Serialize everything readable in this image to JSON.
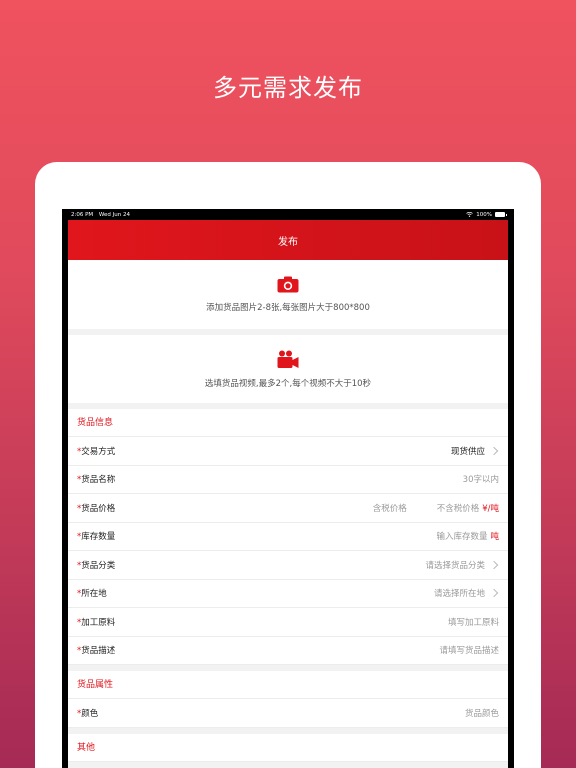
{
  "headline": "多元需求发布",
  "status_bar": {
    "time": "2:06 PM",
    "date": "Wed Jun 24",
    "battery": "100%"
  },
  "nav": {
    "title": "发布"
  },
  "photo_upload": {
    "icon": "camera-icon",
    "hint": "添加货品图片2-8张,每张图片大于800*800"
  },
  "video_upload": {
    "icon": "video-camera-icon",
    "hint": "选填货品视频,最多2个,每个视频不大于10秒"
  },
  "sections": {
    "goods_info": "货品信息",
    "goods_attrs": "货品属性",
    "other": "其他"
  },
  "form": {
    "required_mark": "*",
    "trade_mode": {
      "label": "交易方式",
      "value": "现货供应"
    },
    "goods_name": {
      "label": "货品名称",
      "placeholder": "30字以内"
    },
    "price": {
      "label": "货品价格",
      "incl_tax": "含税价格",
      "excl_tax": "不含税价格",
      "unit": "¥/吨"
    },
    "stock": {
      "label": "库存数量",
      "placeholder": "输入库存数量",
      "unit": "吨"
    },
    "category": {
      "label": "货品分类",
      "placeholder": "请选择货品分类"
    },
    "location": {
      "label": "所在地",
      "placeholder": "请选择所在地"
    },
    "raw_material": {
      "label": "加工原料",
      "placeholder": "填写加工原料"
    },
    "description": {
      "label": "货品描述",
      "placeholder": "请填写货品描述"
    },
    "color": {
      "label": "颜色",
      "placeholder": "货品颜色"
    }
  },
  "colors": {
    "accent": "#e0161c",
    "background_top": "#f0525e",
    "background_bottom": "#a52a55"
  }
}
